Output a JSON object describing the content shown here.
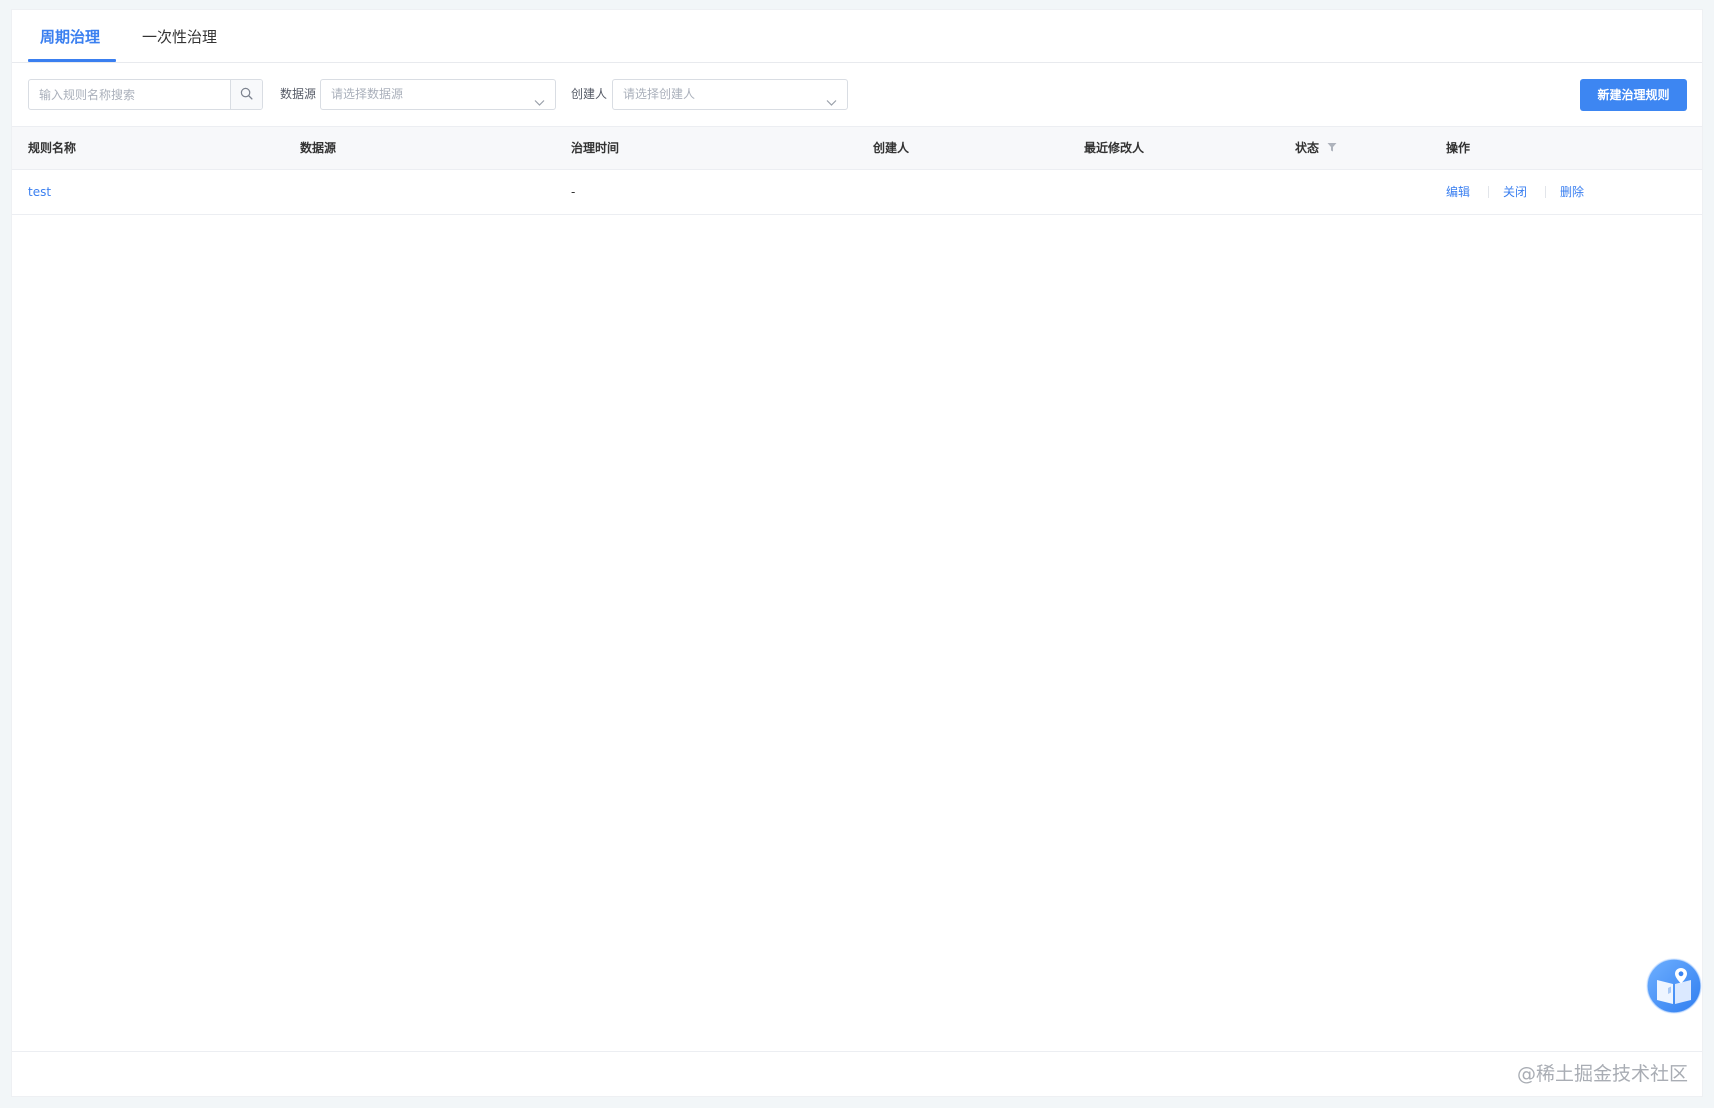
{
  "tabs": [
    {
      "label": "周期治理",
      "active": true
    },
    {
      "label": "一次性治理",
      "active": false
    }
  ],
  "toolbar": {
    "search_placeholder": "输入规则名称搜索",
    "datasource_label": "数据源",
    "datasource_placeholder": "请选择数据源",
    "creator_label": "创建人",
    "creator_placeholder": "请选择创建人",
    "new_rule_button": "新建治理规则"
  },
  "table": {
    "columns": [
      "规则名称",
      "数据源",
      "治理时间",
      "创建人",
      "最近修改人",
      "状态",
      "操作"
    ],
    "rows": [
      {
        "name": "test",
        "datasource": "",
        "time": "-",
        "creator": "",
        "modifier": "",
        "status": "",
        "actions": [
          "编辑",
          "关闭",
          "删除"
        ]
      }
    ]
  },
  "watermark": "@稀土掘金技术社区",
  "colors": {
    "accent": "#3a7ff0",
    "primary_button": "#3d86f2",
    "page_bg": "#f2f6f8"
  },
  "icons": {
    "search": "search-icon",
    "chevron": "chevron-down-icon",
    "filter": "filter-icon",
    "help": "guide-book-icon"
  }
}
